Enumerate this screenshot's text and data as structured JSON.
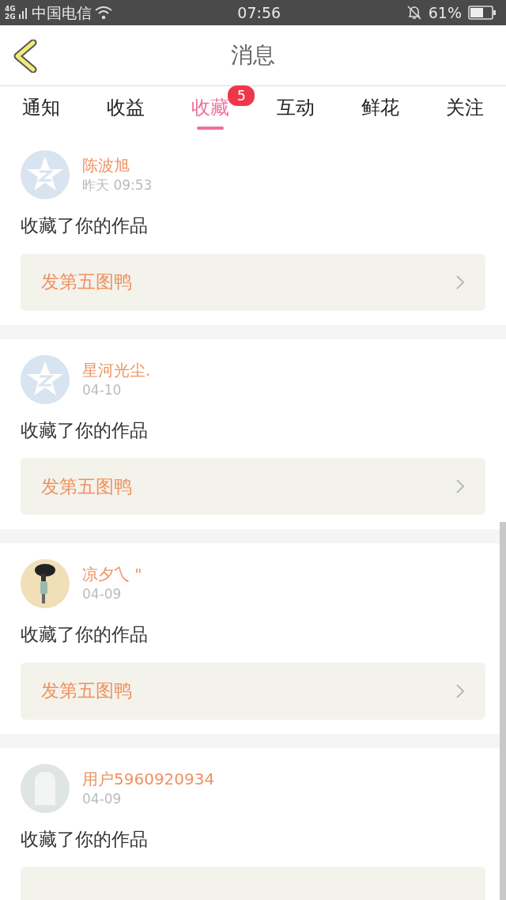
{
  "status_bar": {
    "network_top": "4G",
    "network_bottom": "2G",
    "carrier": "中国电信",
    "time": "07:56",
    "battery": "61%"
  },
  "header": {
    "title": "消息"
  },
  "tabs": [
    {
      "label": "通知",
      "selected": false
    },
    {
      "label": "收益",
      "selected": false
    },
    {
      "label": "收藏",
      "selected": true,
      "badge": "5"
    },
    {
      "label": "互动",
      "selected": false
    },
    {
      "label": "鲜花",
      "selected": false
    },
    {
      "label": "关注",
      "selected": false
    }
  ],
  "messages": [
    {
      "avatar": {
        "kind": "star"
      },
      "user": "陈波旭",
      "time": "昨天 09:53",
      "text": "收藏了你的作品",
      "work": {
        "kind": "card",
        "title": "发第五图鸭"
      }
    },
    {
      "avatar": {
        "kind": "star"
      },
      "user": "星河光尘.",
      "time": "04-10",
      "text": "收藏了你的作品",
      "work": {
        "kind": "card",
        "title": "发第五图鸭"
      }
    },
    {
      "user": "凉夕乀 \"",
      "time": "04-09",
      "text": "收藏了你的作品",
      "work": {
        "kind": "card",
        "title": "发第五图鸭"
      }
    },
    {
      "avatar": {
        "kind": "silhouette"
      },
      "user": "用户5960920934",
      "time": "04-09",
      "text": "收藏了你的作品",
      "work": {
        "kind": "card"
      }
    }
  ]
}
